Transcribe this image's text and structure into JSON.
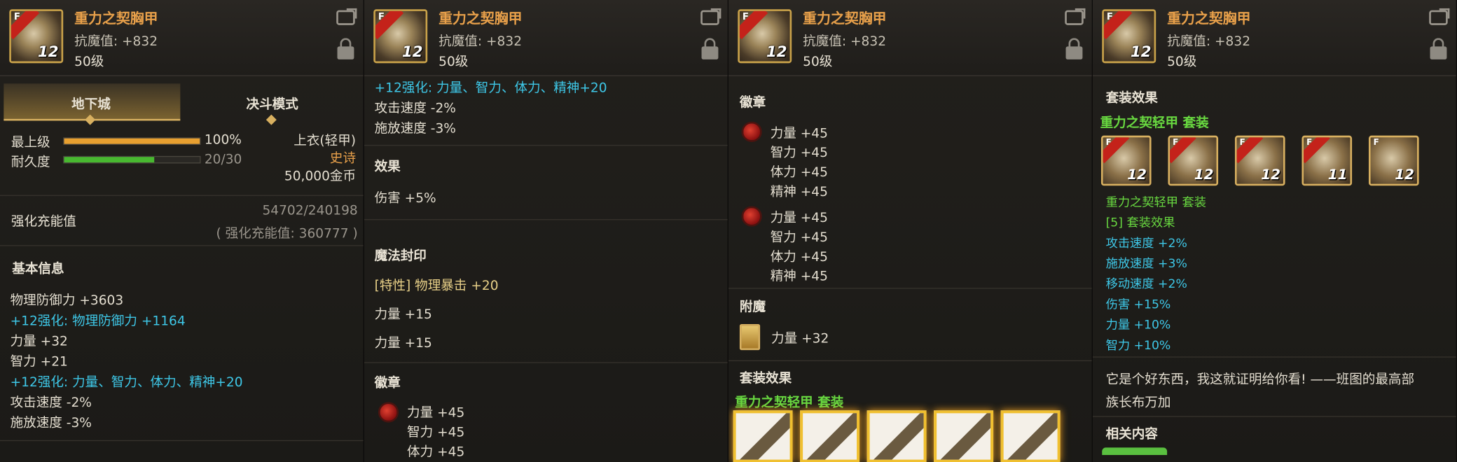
{
  "item": {
    "name": "重力之契胸甲",
    "resist": "抗魔值: +832",
    "level": "50级",
    "icon_badge": "F",
    "icon_level": "12"
  },
  "panel1": {
    "tabs": [
      "地下城",
      "决斗模式"
    ],
    "max_level_label": "最上级",
    "max_level_pct": "100%",
    "durability_label": "耐久度",
    "durability_value": "20/30",
    "slot": "上衣(轻甲)",
    "rarity": "史诗",
    "price": "50,000金币",
    "charge_label": "强化充能值",
    "charge_value": "54702/240198",
    "charge_note": "( 强化充能值: 360777 )",
    "basic_title": "基本信息",
    "basic_lines": [
      {
        "text": "物理防御力 +3603",
        "color": "w"
      },
      {
        "text": "+12强化: 物理防御力 +1164",
        "color": "c"
      },
      {
        "text": "力量 +32",
        "color": "w"
      },
      {
        "text": "智力 +21",
        "color": "w"
      },
      {
        "text": "+12强化: 力量、智力、体力、精神+20",
        "color": "c"
      },
      {
        "text": "攻击速度 -2%",
        "color": "w"
      },
      {
        "text": "施放速度 -3%",
        "color": "w"
      }
    ]
  },
  "panel2": {
    "lines_top": [
      {
        "text": "+12强化: 力量、智力、体力、精神+20",
        "color": "c"
      },
      {
        "text": "攻击速度 -2%",
        "color": "w"
      },
      {
        "text": "施放速度 -3%",
        "color": "w"
      }
    ],
    "effect_title": "效果",
    "effect_line": "伤害 +5%",
    "seal_title": "魔法封印",
    "seal_special": "[特性] 物理暴击 +20",
    "seal_lines": [
      "力量 +15",
      "力量 +15"
    ],
    "badge_title": "徽章",
    "badge_lines": [
      "力量 +45",
      "智力 +45",
      "体力 +45"
    ]
  },
  "panel3": {
    "badge_title": "徽章",
    "badge_group1": [
      "力量 +45",
      "智力 +45",
      "体力 +45",
      "精神 +45"
    ],
    "badge_group2": [
      "力量 +45",
      "智力 +45",
      "体力 +45",
      "精神 +45"
    ],
    "enchant_title": "附魔",
    "enchant_line": "力量 +32",
    "set_title": "套装效果",
    "set_name": "重力之契轻甲 套装"
  },
  "panel4": {
    "set_title": "套装效果",
    "set_name": "重力之契轻甲 套装",
    "set_icon_levels": [
      "12",
      "12",
      "12",
      "11",
      "12"
    ],
    "set_name2": "重力之契轻甲 套装",
    "set_count": "[5] 套装效果",
    "set_lines": [
      "攻击速度 +2%",
      "施放速度 +3%",
      "移动速度 +2%",
      "伤害 +15%",
      "力量 +10%",
      "智力 +10%"
    ],
    "quote_line1": "它是个好东西，我这就证明给你看!  ——班图的最高部",
    "quote_line2": "族长布万加",
    "related_title": "相关内容"
  },
  "colors": {
    "title": "#e8a04a",
    "enhance": "#3ec8e8",
    "set": "#68d840",
    "rarity": "#e8a04a"
  }
}
